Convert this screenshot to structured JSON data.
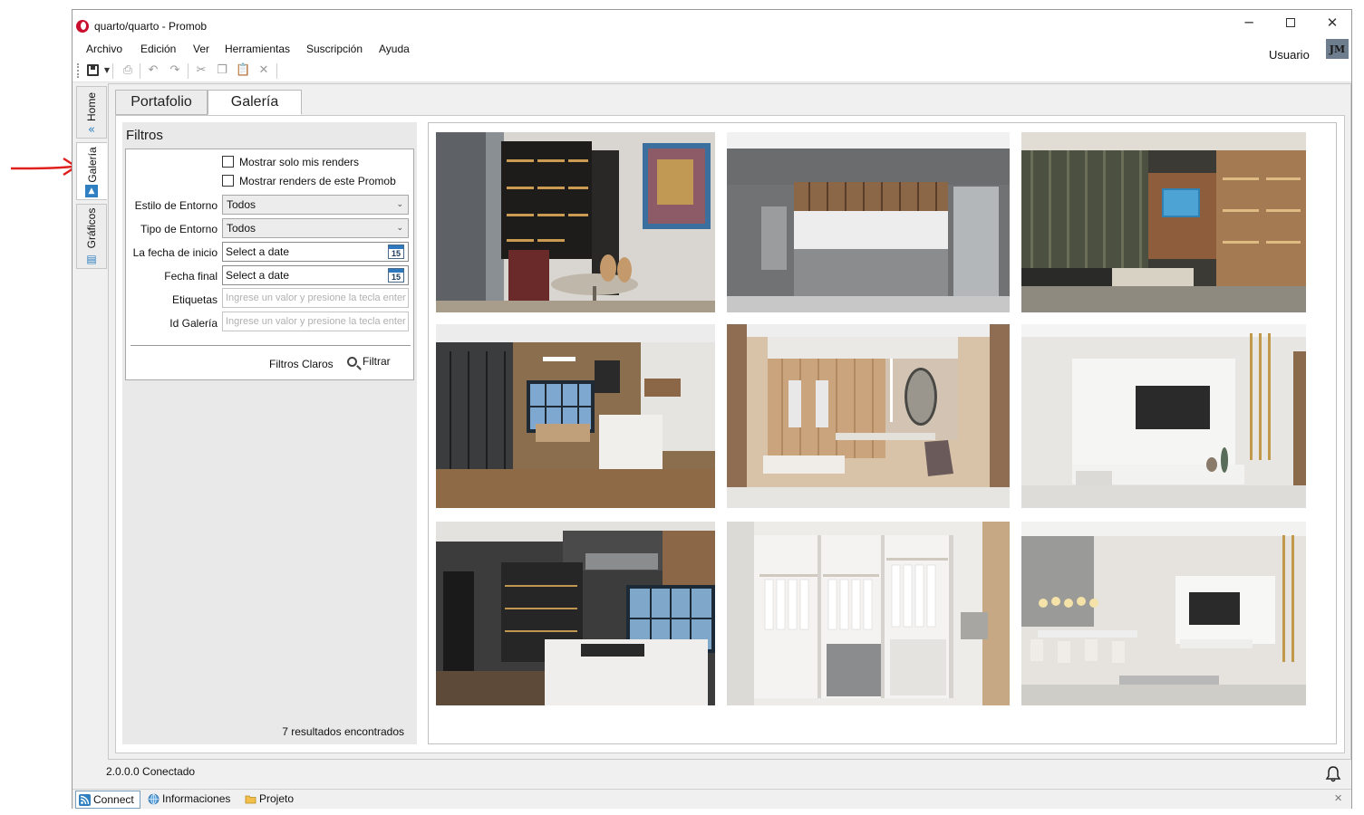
{
  "window": {
    "title": "quarto/quarto - Promob"
  },
  "menu": {
    "items": [
      "Archivo",
      "Edición",
      "Ver",
      "Herramientas",
      "Suscripción",
      "Ayuda"
    ]
  },
  "user": {
    "label": "Usuario",
    "initials": "JM"
  },
  "side_tabs": {
    "home": "Home",
    "galeria": "Galería",
    "graficos": "Gráficos"
  },
  "tabs": {
    "portafolio": "Portafolio",
    "galeria": "Galería",
    "active": "Galería"
  },
  "filters": {
    "title": "Filtros",
    "only_my_renders": {
      "label": "Mostrar solo mis renders",
      "checked": false
    },
    "this_promob_renders": {
      "label": "Mostrar renders de este Promob",
      "checked": false
    },
    "environment_style": {
      "label": "Estilo de Entorno",
      "value": "Todos"
    },
    "environment_type": {
      "label": "Tipo de Entorno",
      "value": "Todos"
    },
    "start_date": {
      "label": "La fecha de inicio",
      "value": "Select a date"
    },
    "end_date": {
      "label": "Fecha final",
      "value": "Select a date"
    },
    "calendar_day": "15",
    "tags": {
      "label": "Etiquetas",
      "placeholder": "Ingrese un valor y presione la tecla enter"
    },
    "gallery_id": {
      "label": "Id Galería",
      "placeholder": "Ingrese un valor y presione la tecla enter"
    },
    "clear_label": "Filtros Claros",
    "filter_label": "Filtrar",
    "results": "7 resultados encontrados"
  },
  "status": {
    "version": "2.0.0.0",
    "connection": "Conectado"
  },
  "bottom_tabs": {
    "connect": "Connect",
    "info": "Informaciones",
    "project": "Projeto"
  },
  "colors": {
    "accent_red": "#e0201c",
    "tab_blue": "#2f7fc1"
  }
}
